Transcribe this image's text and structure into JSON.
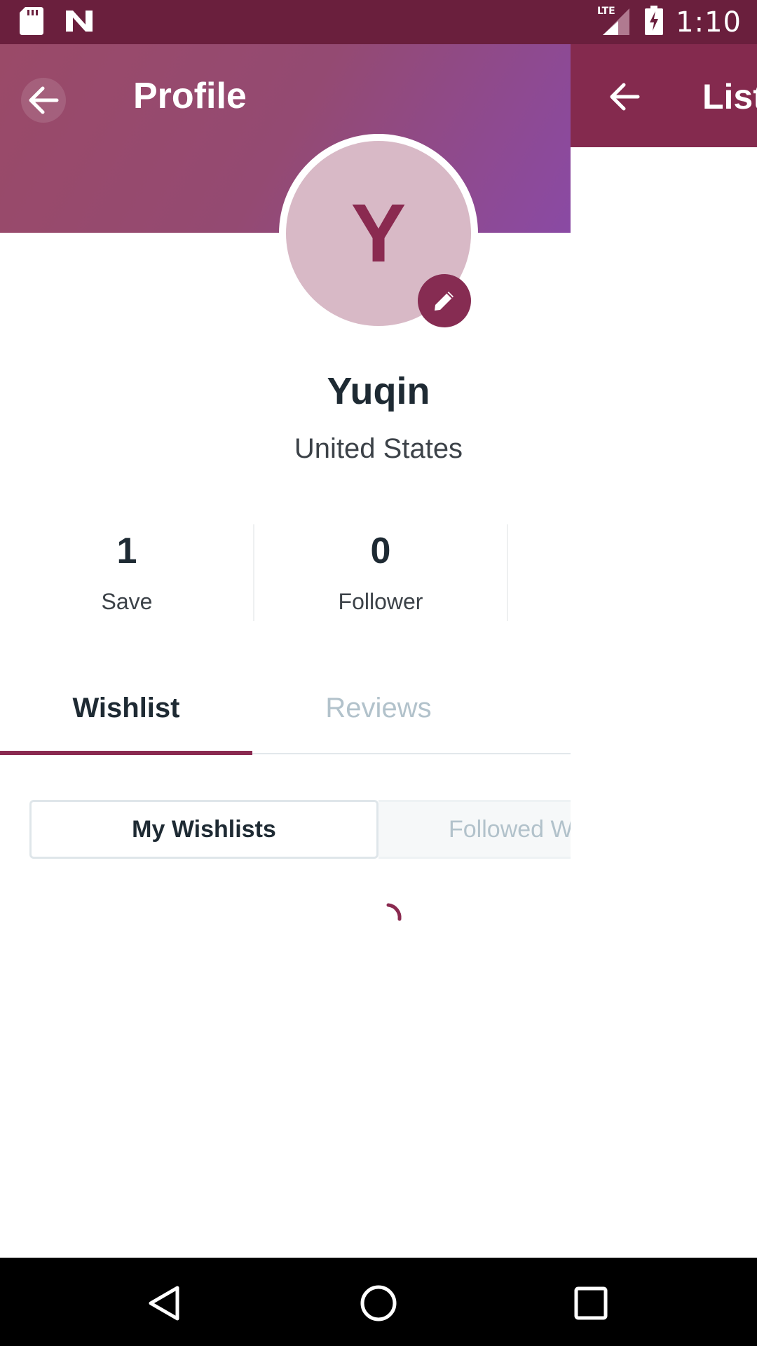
{
  "status_bar": {
    "time": "1:10",
    "network": "LTE",
    "icons": [
      "sd-card-icon",
      "n-notification-icon",
      "signal-icon",
      "battery-charging-icon"
    ]
  },
  "next_screen": {
    "title": "List",
    "back_icon": "arrow-left-icon"
  },
  "header": {
    "title": "Profile",
    "back_icon": "arrow-left-icon"
  },
  "profile": {
    "initial": "Y",
    "name": "Yuqin",
    "location": "United States",
    "edit_icon": "pencil-icon"
  },
  "stats": [
    {
      "value": "1",
      "label": "Save"
    },
    {
      "value": "0",
      "label": "Follower"
    }
  ],
  "tabs": [
    {
      "label": "Wishlist",
      "active": true
    },
    {
      "label": "Reviews",
      "active": false
    }
  ],
  "segments": [
    {
      "label": "My Wishlists",
      "selected": true
    },
    {
      "label": "Followed Wishlists",
      "selected": false
    }
  ],
  "colors": {
    "brand": "#8a2a50",
    "status_bar": "#6a1f3d",
    "header_gradient_start": "#9a4a68",
    "header_gradient_end": "#8a4aa4",
    "avatar_bg": "#d8b9c6"
  },
  "nav_bar": {
    "icons": [
      "back-triangle-icon",
      "home-circle-icon",
      "recents-square-icon"
    ]
  }
}
